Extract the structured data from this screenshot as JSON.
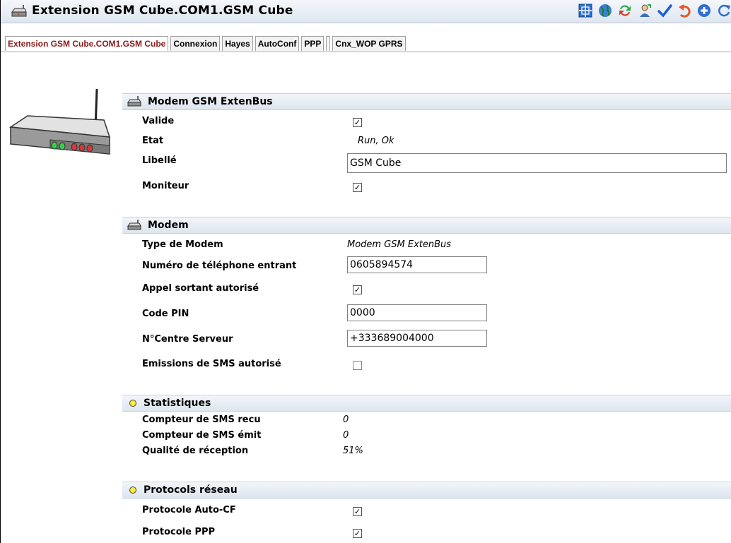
{
  "window": {
    "title": "Extension GSM Cube.COM1.GSM Cube",
    "toolbar": [
      {
        "icon": "grid-icon",
        "color": "#2b6fd6"
      },
      {
        "icon": "globe-icon",
        "color": "#2a9a3b"
      },
      {
        "icon": "refresh-green-red-icon",
        "color": "#2aa84a"
      },
      {
        "icon": "user-settings-icon",
        "color": "#3d6fb8"
      },
      {
        "icon": "checkmark-icon",
        "color": "#1d5fcf"
      },
      {
        "icon": "undo-icon",
        "color": "#e05a2b"
      },
      {
        "icon": "add-circle-icon",
        "color": "#2c6fd0"
      },
      {
        "icon": "reload-icon",
        "color": "#2c6fd0"
      }
    ]
  },
  "tabs": [
    {
      "label": "Extension GSM Cube.COM1.GSM Cube",
      "active": true
    },
    {
      "label": "Connexion"
    },
    {
      "label": "Hayes"
    },
    {
      "label": "AutoConf"
    },
    {
      "label": "PPP"
    },
    {
      "label": ""
    },
    {
      "label": "Cnx_WOP GPRS"
    }
  ],
  "sections": {
    "modem_gsm": {
      "title": "Modem GSM ExtenBus",
      "valide_label": "Valide",
      "valide_checked": true,
      "etat_label": "Etat",
      "etat_value": "Run, Ok",
      "libelle_label": "Libellé",
      "libelle_value": "GSM Cube",
      "moniteur_label": "Moniteur",
      "moniteur_checked": true
    },
    "modem": {
      "title": "Modem",
      "type_label": "Type de Modem",
      "type_value": "Modem GSM ExtenBus",
      "numero_label": "Numéro de téléphone entrant",
      "numero_value": "0605894574",
      "appel_label": "Appel sortant autorisé",
      "appel_checked": true,
      "pin_label": "Code PIN",
      "pin_value": "0000",
      "centre_label": "N°Centre Serveur",
      "centre_value": "+333689004000",
      "sms_label": "Emissions de SMS autorisé",
      "sms_checked": false
    },
    "statistiques": {
      "title": "Statistiques",
      "recu_label": "Compteur de SMS recu",
      "recu_value": "0",
      "emit_label": "Compteur de SMS émit",
      "emit_value": "0",
      "qualite_label": "Qualité de réception",
      "qualite_value": "51%"
    },
    "protocols": {
      "title": "Protocols réseau",
      "autocf_label": "Protocole Auto-CF",
      "autocf_checked": true,
      "ppp_label": "Protocole PPP",
      "ppp_checked": true
    }
  }
}
